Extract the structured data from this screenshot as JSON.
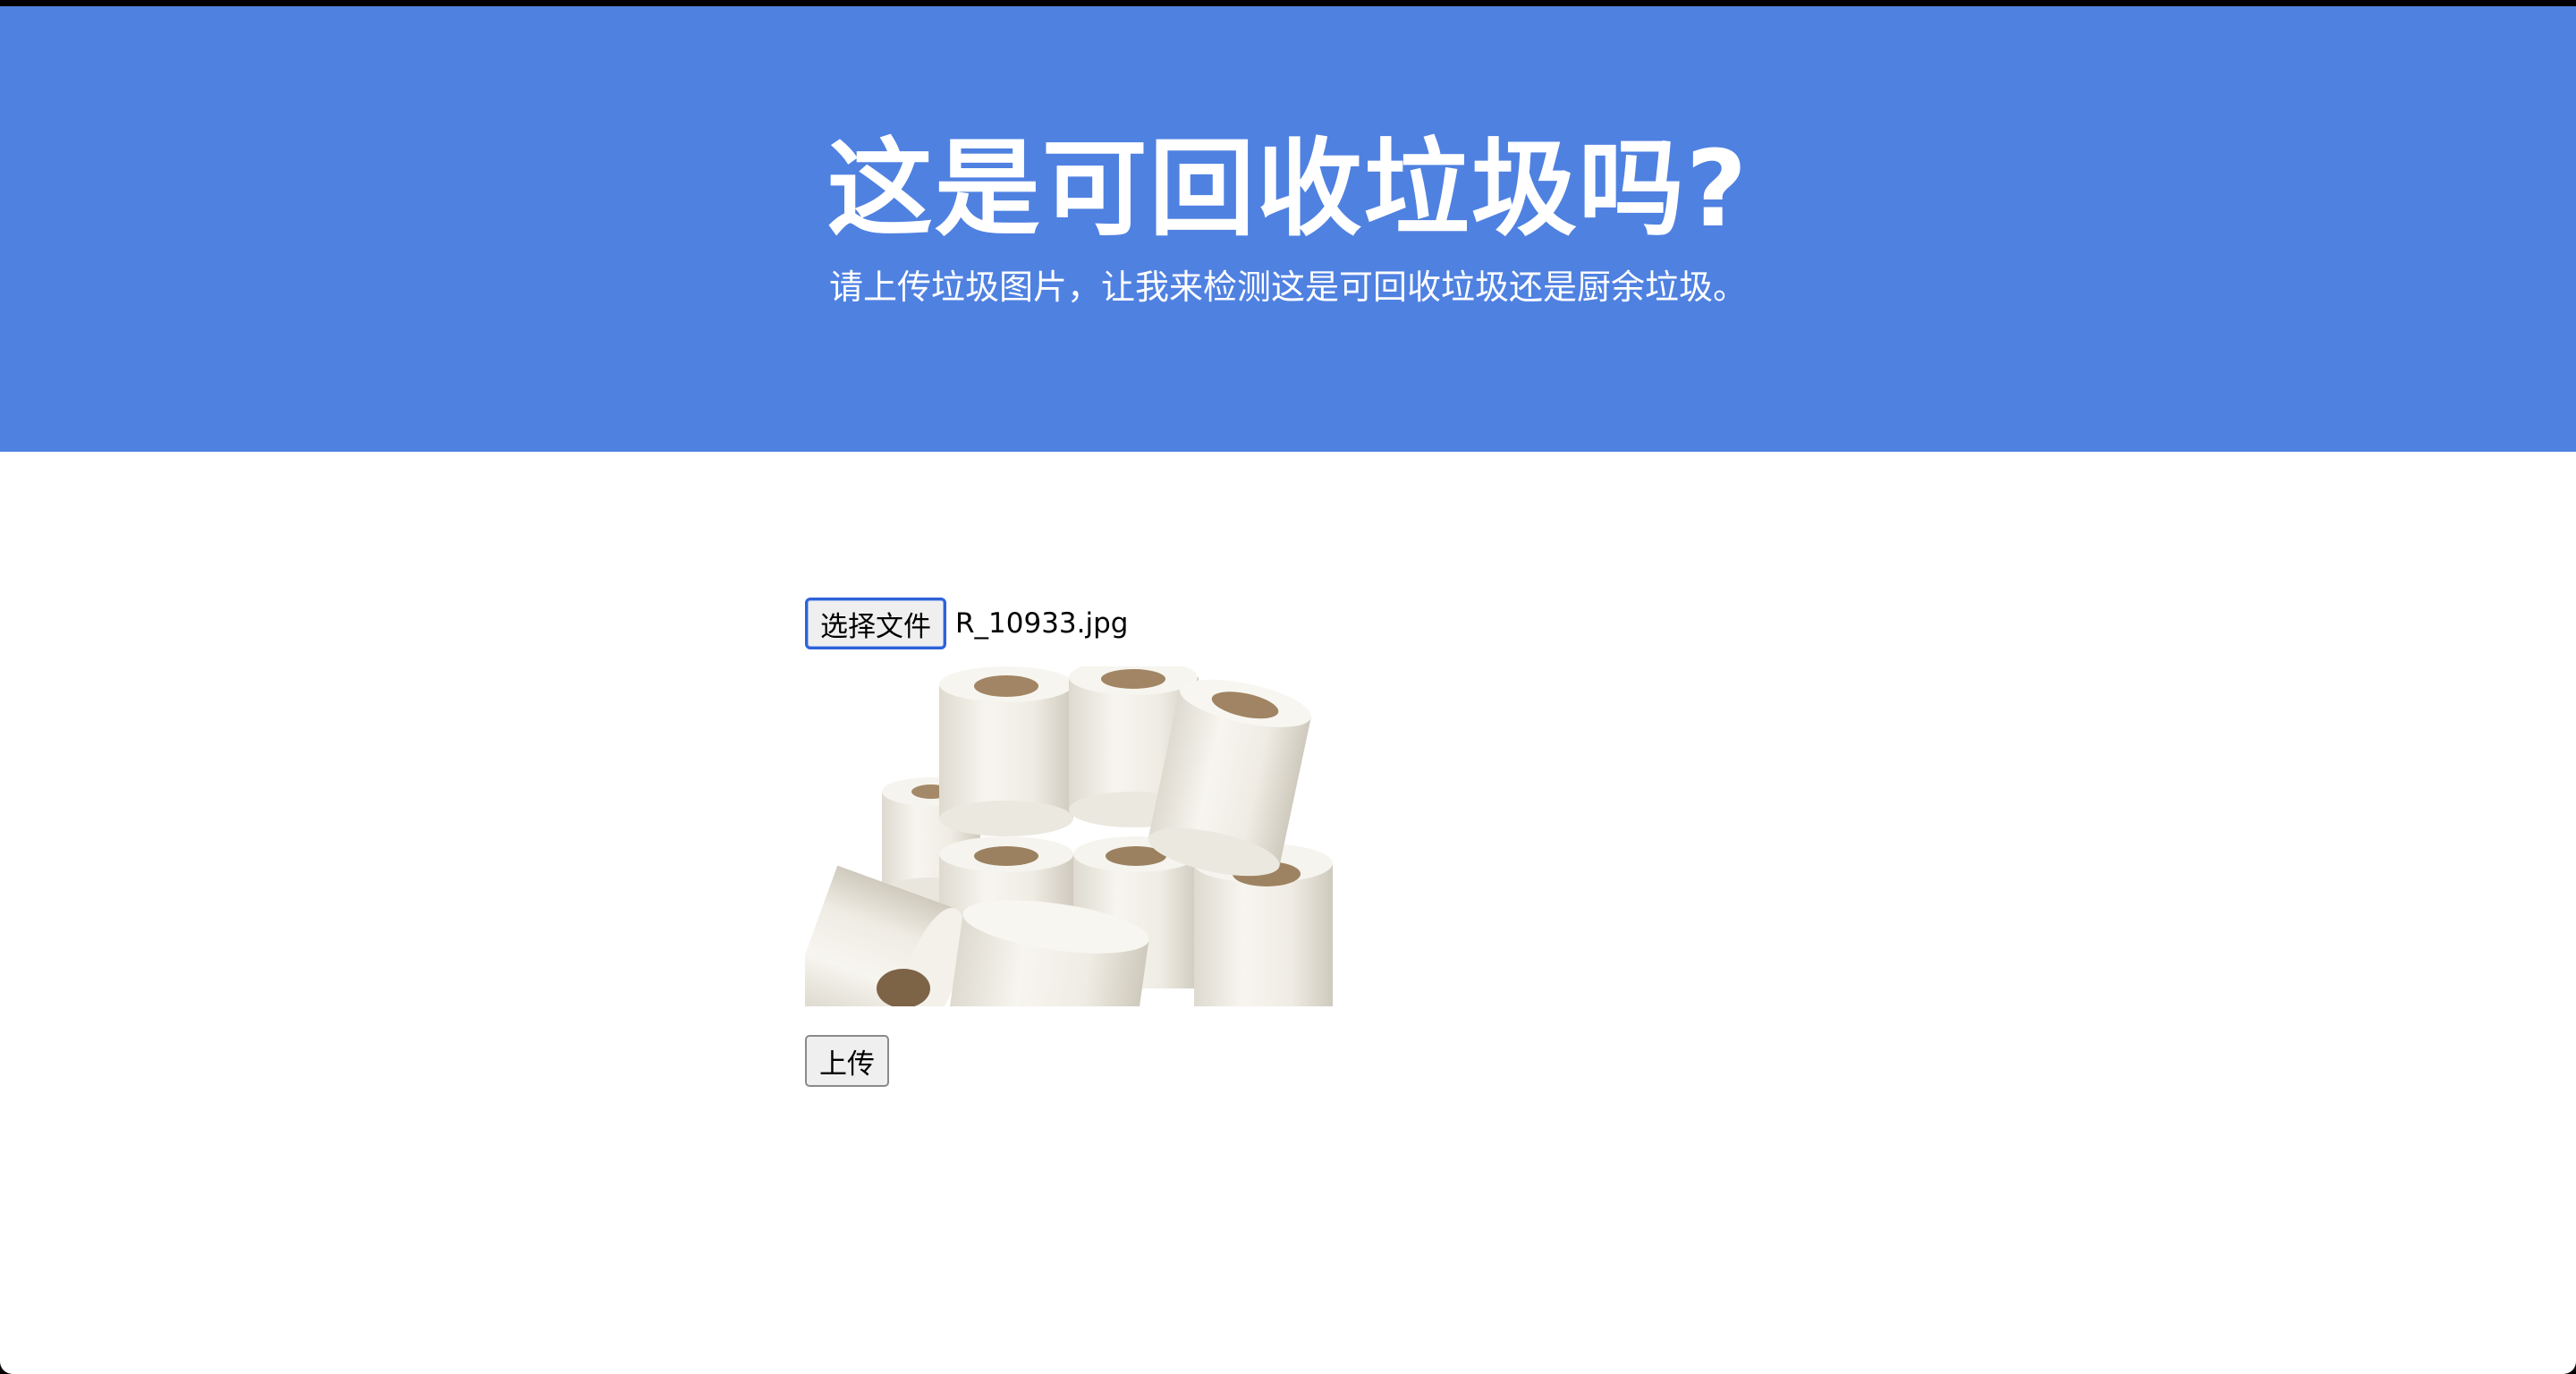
{
  "hero": {
    "title": "这是可回收垃圾吗?",
    "subtitle": "请上传垃圾图片，让我来检测这是可回收垃圾还是厨余垃圾。",
    "background_color": "#4f81e1",
    "text_color": "#ffffff"
  },
  "file_input": {
    "button_label": "选择文件",
    "file_name": "R_10933.jpg",
    "focus_color": "#2d62d8"
  },
  "preview": {
    "icon": "toilet-paper-rolls-image"
  },
  "upload": {
    "button_label": "上传"
  }
}
